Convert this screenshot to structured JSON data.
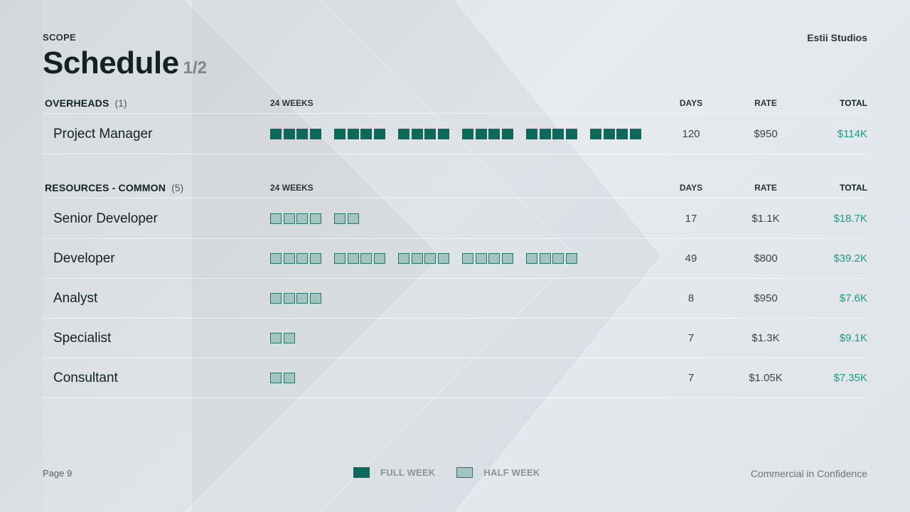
{
  "header": {
    "kicker": "SCOPE",
    "title": "Schedule",
    "title_page": "1/2",
    "brand": "Estii Studios"
  },
  "sections": [
    {
      "name": "OVERHEADS",
      "count": "(1)",
      "weeks_label": "24 WEEKS",
      "col_days": "DAYS",
      "col_rate": "RATE",
      "col_total": "TOTAL",
      "rows": [
        {
          "role": "Project Manager",
          "full_weeks": 24,
          "half_weeks": 0,
          "days": "120",
          "rate": "$950",
          "total": "$114K"
        }
      ]
    },
    {
      "name": "RESOURCES - COMMON",
      "count": "(5)",
      "weeks_label": "24 WEEKS",
      "col_days": "DAYS",
      "col_rate": "RATE",
      "col_total": "TOTAL",
      "rows": [
        {
          "role": "Senior Developer",
          "full_weeks": 0,
          "half_weeks": 6,
          "days": "17",
          "rate": "$1.1K",
          "total": "$18.7K"
        },
        {
          "role": "Developer",
          "full_weeks": 0,
          "half_weeks": 20,
          "days": "49",
          "rate": "$800",
          "total": "$39.2K"
        },
        {
          "role": "Analyst",
          "full_weeks": 0,
          "half_weeks": 4,
          "days": "8",
          "rate": "$950",
          "total": "$7.6K"
        },
        {
          "role": "Specialist",
          "full_weeks": 0,
          "half_weeks": 2,
          "days": "7",
          "rate": "$1.3K",
          "total": "$9.1K"
        },
        {
          "role": "Consultant",
          "full_weeks": 0,
          "half_weeks": 2,
          "days": "7",
          "rate": "$1.05K",
          "total": "$7.35K"
        }
      ]
    }
  ],
  "legend": {
    "full_label": "FULL WEEK",
    "half_label": "HALF WEEK"
  },
  "footer": {
    "page": "Page 9",
    "confidentiality": "Commercial in Confidence"
  },
  "colors": {
    "full_week": "#0d6a5a",
    "half_week_fill": "#a3c4c0",
    "half_week_border": "#2d7365",
    "total_text": "#1a9a86"
  }
}
